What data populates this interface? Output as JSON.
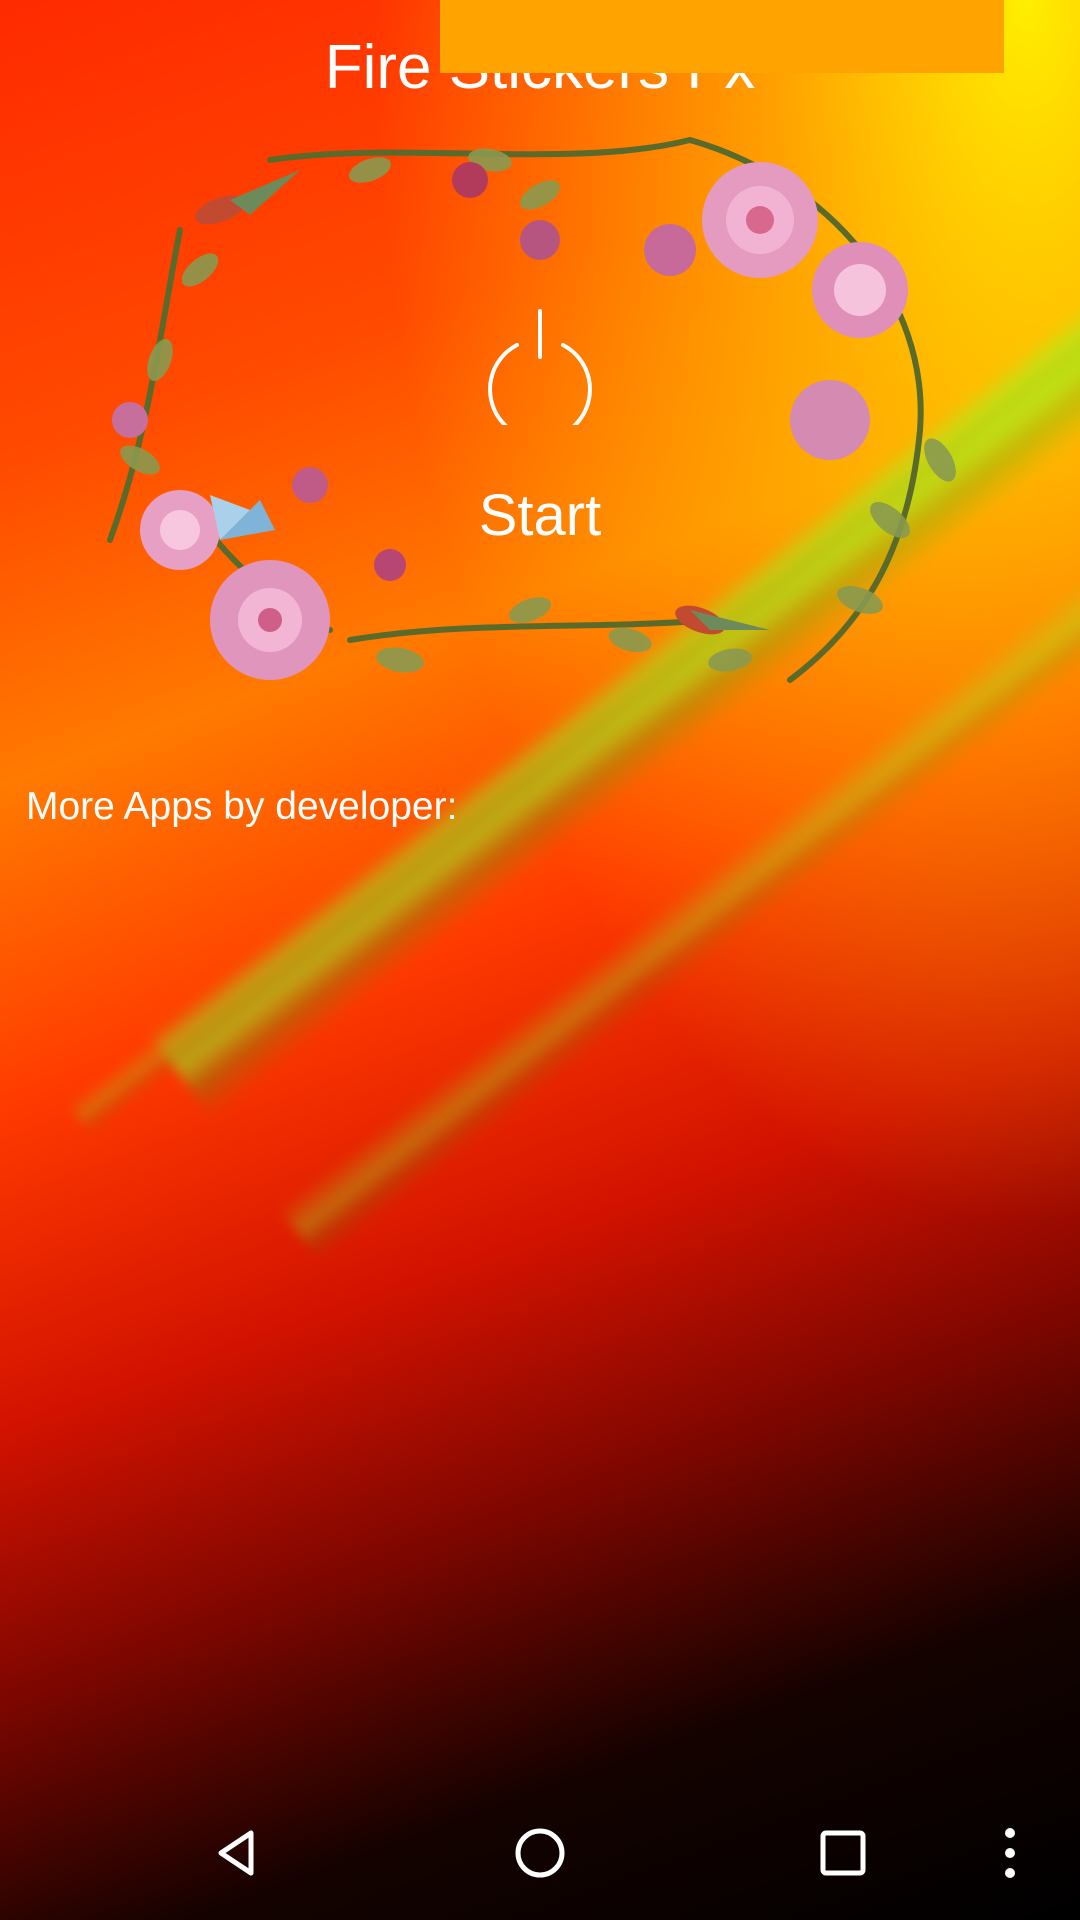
{
  "app": {
    "title": "Fire Stickers Fx",
    "start_label": "Start",
    "more_apps_label": "More Apps by developer:"
  },
  "icons": {
    "power": "power-icon",
    "back": "back-icon",
    "home": "home-icon",
    "recents": "recents-icon",
    "menu": "more-vert-icon"
  },
  "colors": {
    "banner": "#ffa300",
    "text": "#ffffff"
  }
}
